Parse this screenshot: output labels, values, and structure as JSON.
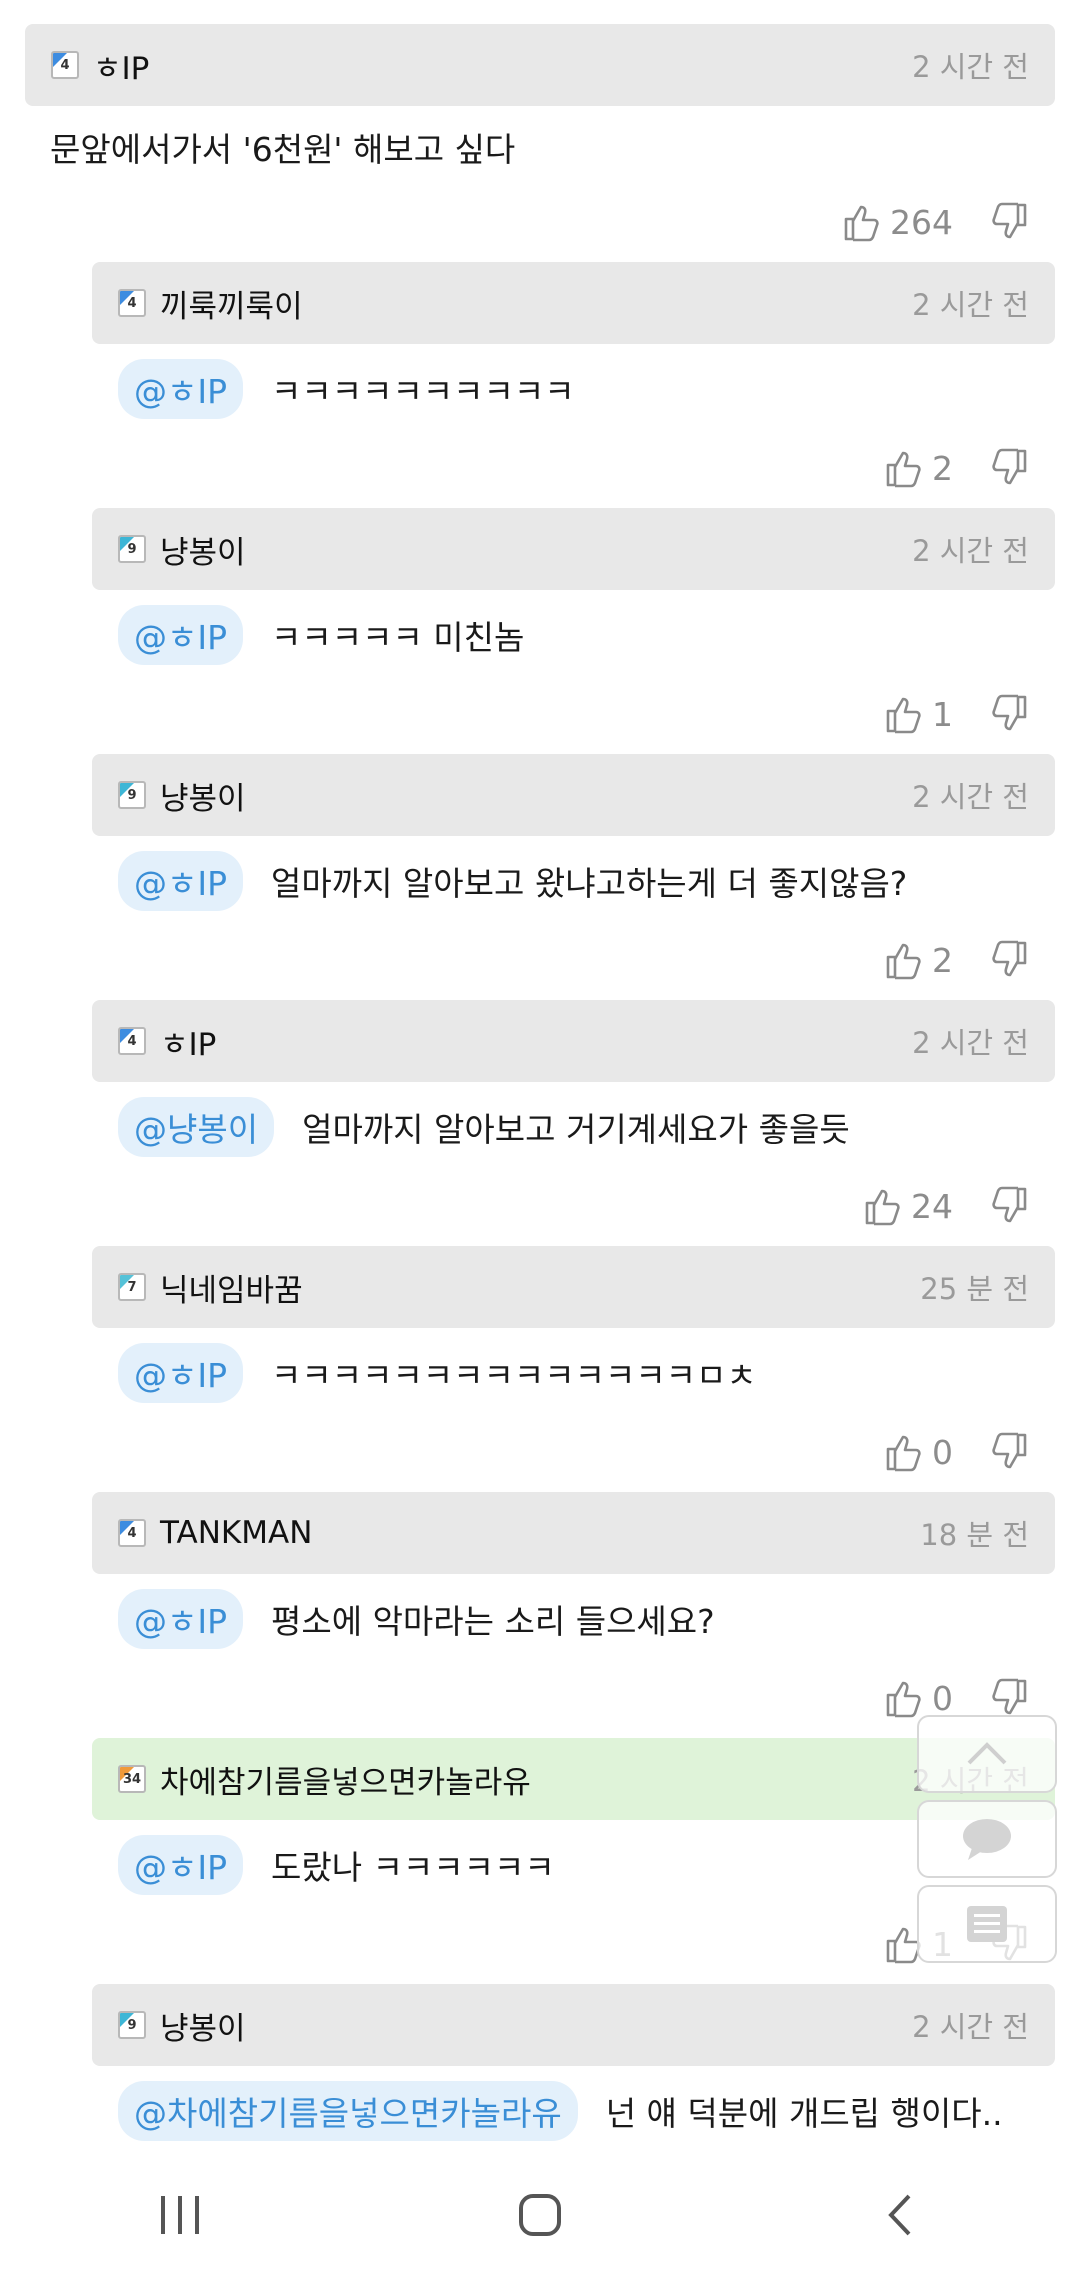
{
  "comments": [
    {
      "level": "4",
      "level_color": "c4",
      "nick": "ㅎIP",
      "time": "2 시간 전",
      "mention": "",
      "text": "문앞에서가서 '6천원' 해보고 싶다",
      "likes": "264",
      "reply": false,
      "highlight": false
    },
    {
      "level": "4",
      "level_color": "c4",
      "nick": "끼룩끼룩이",
      "time": "2 시간 전",
      "mention": "@ㅎIP",
      "text": "ㅋㅋㅋㅋㅋㅋㅋㅋㅋㅋ",
      "likes": "2",
      "reply": true,
      "highlight": false
    },
    {
      "level": "9",
      "level_color": "c9",
      "nick": "냥봉이",
      "time": "2 시간 전",
      "mention": "@ㅎIP",
      "text": "ㅋㅋㅋㅋㅋ 미친놈",
      "likes": "1",
      "reply": true,
      "highlight": false
    },
    {
      "level": "9",
      "level_color": "c9",
      "nick": "냥봉이",
      "time": "2 시간 전",
      "mention": "@ㅎIP",
      "text": "얼마까지 알아보고 왔냐고하는게 더 좋지않음?",
      "likes": "2",
      "reply": true,
      "highlight": false
    },
    {
      "level": "4",
      "level_color": "c4",
      "nick": "ㅎIP",
      "time": "2 시간 전",
      "mention": "@냥봉이",
      "text": "얼마까지 알아보고 거기계세요가 좋을듯",
      "likes": "24",
      "reply": true,
      "highlight": false
    },
    {
      "level": "7",
      "level_color": "c7",
      "nick": "닉네임바꿈",
      "time": "25 분 전",
      "mention": "@ㅎIP",
      "text": "ㅋㅋㅋㅋㅋㅋㅋㅋㅋㅋㅋㅋㅋㅋㅁㅊ",
      "likes": "0",
      "reply": true,
      "highlight": false
    },
    {
      "level": "4",
      "level_color": "c4",
      "nick": "TANKMAN",
      "time": "18 분 전",
      "mention": "@ㅎIP",
      "text": "평소에 악마라는 소리 들으세요?",
      "likes": "0",
      "reply": true,
      "highlight": false
    },
    {
      "level": "34",
      "level_color": "c34",
      "nick": "차에참기름을넣으면카놀라유",
      "time": "2 시간 전",
      "mention": "@ㅎIP",
      "text": "도랐나 ㅋㅋㅋㅋㅋㅋ",
      "likes": "1",
      "reply": true,
      "highlight": true
    },
    {
      "level": "9",
      "level_color": "c9",
      "nick": "냥봉이",
      "time": "2 시간 전",
      "mention": "@차에참기름을넣으면카놀라유",
      "text": "넌 얘 덕분에 개드립 행이다..",
      "likes": "",
      "reply": true,
      "highlight": false
    }
  ],
  "floating_buttons": [
    {
      "icon": "chevron-up-icon"
    },
    {
      "icon": "comment-bubble-icon"
    },
    {
      "icon": "list-icon"
    }
  ],
  "navbar": [
    {
      "icon": "recent-apps-icon"
    },
    {
      "icon": "home-icon"
    },
    {
      "icon": "back-icon"
    }
  ]
}
